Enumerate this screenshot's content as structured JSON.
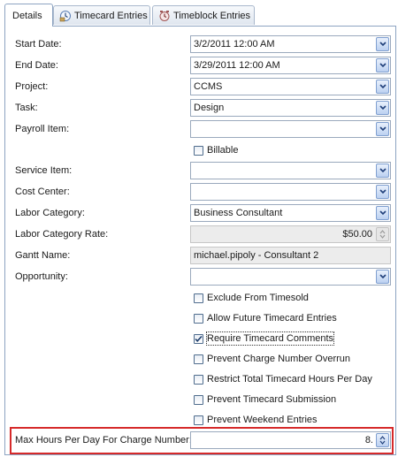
{
  "tabs": [
    {
      "label": "Details",
      "icon": "details-tab-icon"
    },
    {
      "label": "Timecard Entries",
      "icon": "timecard-icon"
    },
    {
      "label": "Timeblock Entries",
      "icon": "timeblock-icon"
    }
  ],
  "form": {
    "start_date": {
      "label": "Start Date:",
      "value": "3/2/2011 12:00 AM"
    },
    "end_date": {
      "label": "End Date:",
      "value": "3/29/2011 12:00 AM"
    },
    "project": {
      "label": "Project:",
      "value": "CCMS"
    },
    "task": {
      "label": "Task:",
      "value": "Design"
    },
    "payroll_item": {
      "label": "Payroll Item:",
      "value": ""
    },
    "billable": {
      "label": "Billable",
      "checked": false
    },
    "service_item": {
      "label": "Service Item:",
      "value": ""
    },
    "cost_center": {
      "label": "Cost Center:",
      "value": ""
    },
    "labor_category": {
      "label": "Labor Category:",
      "value": "Business Consultant"
    },
    "labor_category_rate": {
      "label": "Labor Category Rate:",
      "value": "$50.00"
    },
    "gantt_name": {
      "label": "Gantt Name:",
      "value": "michael.pipoly - Consultant 2"
    },
    "opportunity": {
      "label": "Opportunity:",
      "value": ""
    },
    "checkboxes": [
      {
        "label": "Exclude From Timesold",
        "checked": false
      },
      {
        "label": "Allow Future Timecard Entries",
        "checked": false
      },
      {
        "label": "Require Timecard Comments",
        "checked": true
      },
      {
        "label": "Prevent Charge Number Overrun",
        "checked": false
      },
      {
        "label": "Restrict Total Timecard Hours Per Day",
        "checked": false
      },
      {
        "label": "Prevent Timecard Submission",
        "checked": false
      },
      {
        "label": "Prevent Weekend Entries",
        "checked": false
      }
    ],
    "max_hours": {
      "label": "Max Hours Per Day For Charge Number:",
      "value": "8."
    }
  },
  "colors": {
    "highlight": "#d62a2a",
    "accent": "#7f9fd0"
  }
}
